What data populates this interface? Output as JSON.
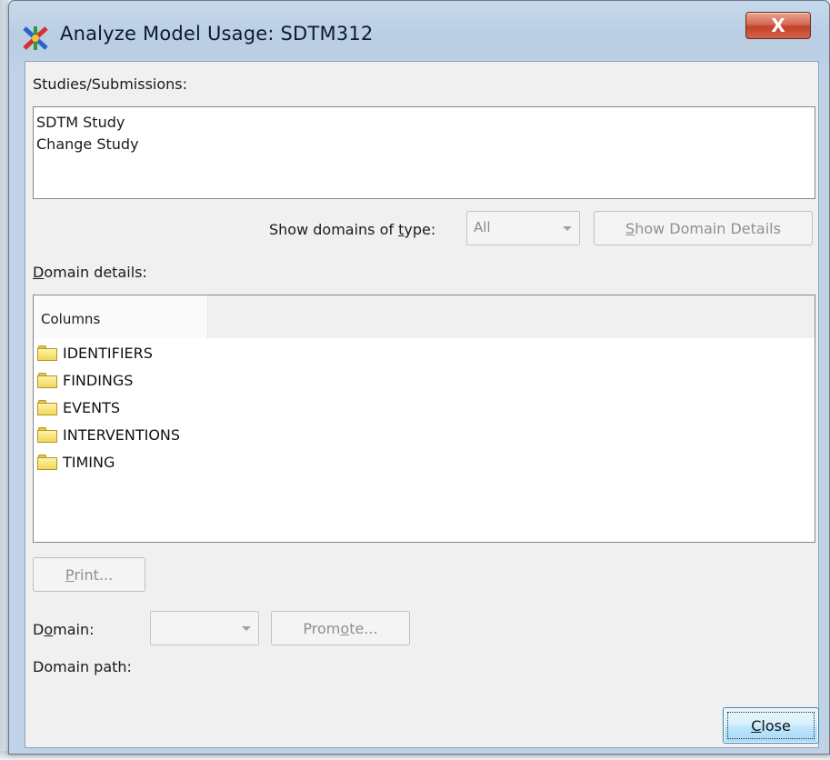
{
  "window": {
    "title": "Analyze Model Usage: SDTM312",
    "close_glyph": "X"
  },
  "studies": {
    "label": "Studies/Submissions:",
    "items": [
      "SDTM Study",
      "Change Study"
    ]
  },
  "filter": {
    "label_before": "Show domains of ",
    "label_accel": "t",
    "label_after": "ype:",
    "type_value": "All",
    "details_button_accel": "S",
    "details_button_rest": "how Domain Details"
  },
  "domain_details": {
    "label_accel": "D",
    "label_rest": "omain details:",
    "column_header": "Columns",
    "folders": [
      "IDENTIFIERS",
      "FINDINGS",
      "EVENTS",
      "INTERVENTIONS",
      "TIMING"
    ],
    "folder_icon": "folder-icon"
  },
  "print_button": {
    "accel": "P",
    "rest": "rint..."
  },
  "domain": {
    "label_before": "D",
    "label_accel": "o",
    "label_after": "main:",
    "value": "",
    "promote_before": "Prom",
    "promote_accel": "o",
    "promote_after": "te..."
  },
  "domain_path": {
    "label": "Domain path:",
    "value": ""
  },
  "close_button": {
    "accel": "C",
    "rest": "lose"
  },
  "colors": {
    "titlebar": "#bfd2e6",
    "client_bg": "#f0f0f0",
    "close_x": "#c1432a",
    "folder": "#f3d65a",
    "default_button": "#bee6fd"
  }
}
